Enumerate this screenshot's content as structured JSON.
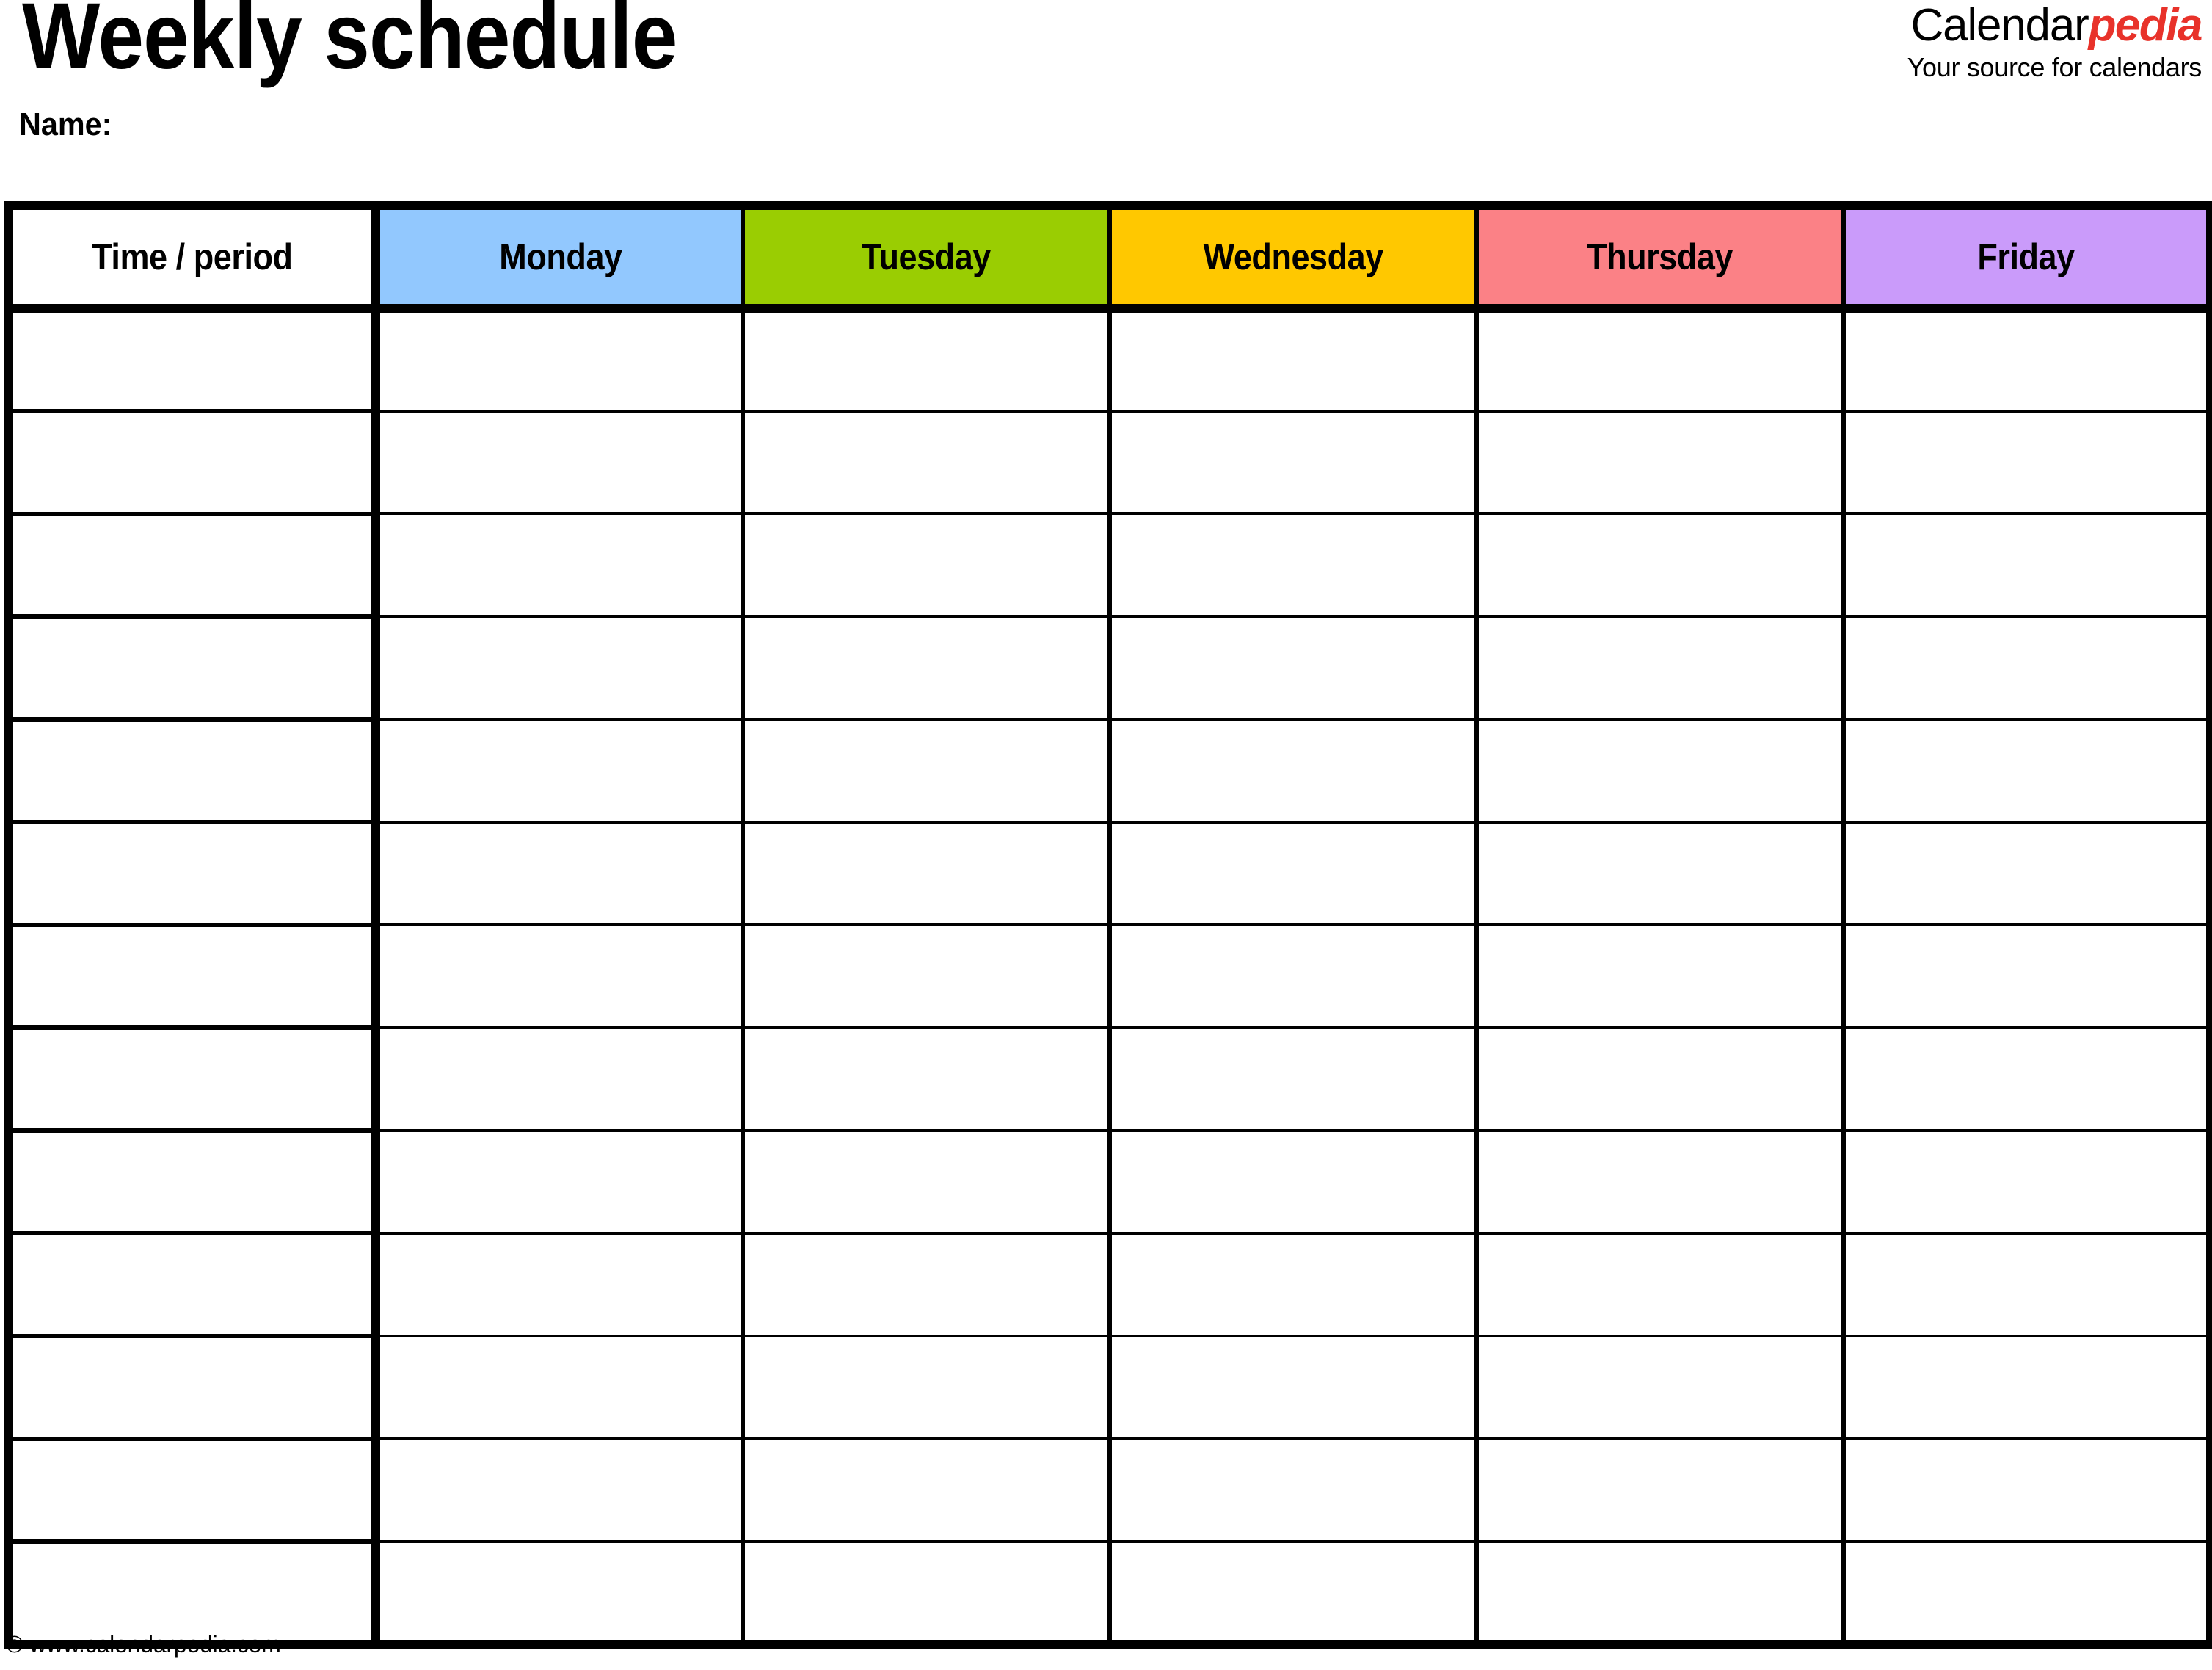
{
  "document": {
    "title": "Weekly schedule",
    "name_label": "Name:"
  },
  "logo": {
    "brand_part_1": "Calendar",
    "brand_part_2": "pedia",
    "tagline": "Your source for calendars",
    "accent_color": "#E8322A"
  },
  "table": {
    "columns": [
      {
        "label": "Time / period",
        "bg": "#FFFFFF",
        "key": "time"
      },
      {
        "label": "Monday",
        "bg": "#92C8FE",
        "key": "monday"
      },
      {
        "label": "Tuesday",
        "bg": "#9ACD02",
        "key": "tuesday"
      },
      {
        "label": "Wednesday",
        "bg": "#FFC800",
        "key": "wednesday"
      },
      {
        "label": "Thursday",
        "bg": "#FB8186",
        "key": "thursday"
      },
      {
        "label": "Friday",
        "bg": "#CA9BFA",
        "key": "friday"
      }
    ],
    "row_count": 13,
    "rows": [
      {
        "time": "",
        "monday": "",
        "tuesday": "",
        "wednesday": "",
        "thursday": "",
        "friday": ""
      },
      {
        "time": "",
        "monday": "",
        "tuesday": "",
        "wednesday": "",
        "thursday": "",
        "friday": ""
      },
      {
        "time": "",
        "monday": "",
        "tuesday": "",
        "wednesday": "",
        "thursday": "",
        "friday": ""
      },
      {
        "time": "",
        "monday": "",
        "tuesday": "",
        "wednesday": "",
        "thursday": "",
        "friday": ""
      },
      {
        "time": "",
        "monday": "",
        "tuesday": "",
        "wednesday": "",
        "thursday": "",
        "friday": ""
      },
      {
        "time": "",
        "monday": "",
        "tuesday": "",
        "wednesday": "",
        "thursday": "",
        "friday": ""
      },
      {
        "time": "",
        "monday": "",
        "tuesday": "",
        "wednesday": "",
        "thursday": "",
        "friday": ""
      },
      {
        "time": "",
        "monday": "",
        "tuesday": "",
        "wednesday": "",
        "thursday": "",
        "friday": ""
      },
      {
        "time": "",
        "monday": "",
        "tuesday": "",
        "wednesday": "",
        "thursday": "",
        "friday": ""
      },
      {
        "time": "",
        "monday": "",
        "tuesday": "",
        "wednesday": "",
        "thursday": "",
        "friday": ""
      },
      {
        "time": "",
        "monday": "",
        "tuesday": "",
        "wednesday": "",
        "thursday": "",
        "friday": ""
      },
      {
        "time": "",
        "monday": "",
        "tuesday": "",
        "wednesday": "",
        "thursday": "",
        "friday": ""
      },
      {
        "time": "",
        "monday": "",
        "tuesday": "",
        "wednesday": "",
        "thursday": "",
        "friday": ""
      }
    ]
  },
  "footer": {
    "copyright": "© www.calendarpedia.com"
  }
}
